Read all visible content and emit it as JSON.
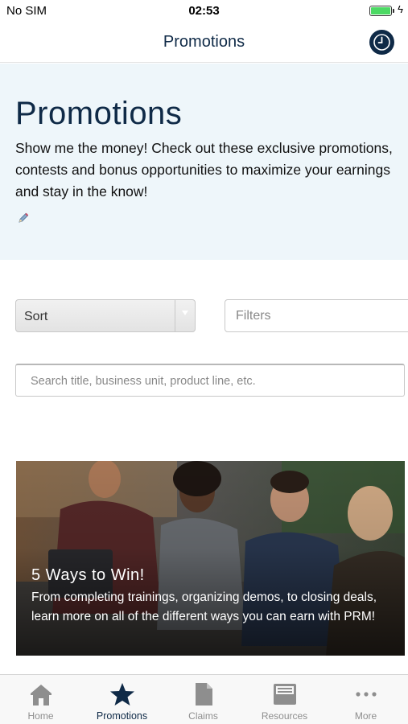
{
  "status_bar": {
    "carrier": "No SIM",
    "time": "02:53",
    "battery_level": 1.0,
    "battery_color": "#4cd964"
  },
  "nav": {
    "title": "Promotions",
    "action_icon": "clock-icon"
  },
  "hero": {
    "title": "Promotions",
    "description": "Show me the money! Check out these exclusive promotions, contests and bonus opportunities to maximize your earnings and stay in the know!",
    "edit_icon": "pencil-icon",
    "background": "#eef6fa"
  },
  "controls": {
    "sort_label": "Sort",
    "filters_placeholder": "Filters",
    "search_placeholder": "Search title, business unit, product line, etc."
  },
  "promo_card": {
    "title": "5 Ways to Win!",
    "description": "From completing trainings, organizing demos, to closing deals, learn more on all of the different ways you can earn with PRM!"
  },
  "tab_bar": {
    "items": [
      {
        "label": "Home",
        "icon": "home-icon"
      },
      {
        "label": "Promotions",
        "icon": "star-icon",
        "active": true
      },
      {
        "label": "Claims",
        "icon": "document-icon"
      },
      {
        "label": "Resources",
        "icon": "inbox-icon"
      },
      {
        "label": "More",
        "icon": "more-icon"
      }
    ]
  },
  "colors": {
    "brand_navy": "#0f2a47",
    "inactive_gray": "#8e8e8e"
  }
}
